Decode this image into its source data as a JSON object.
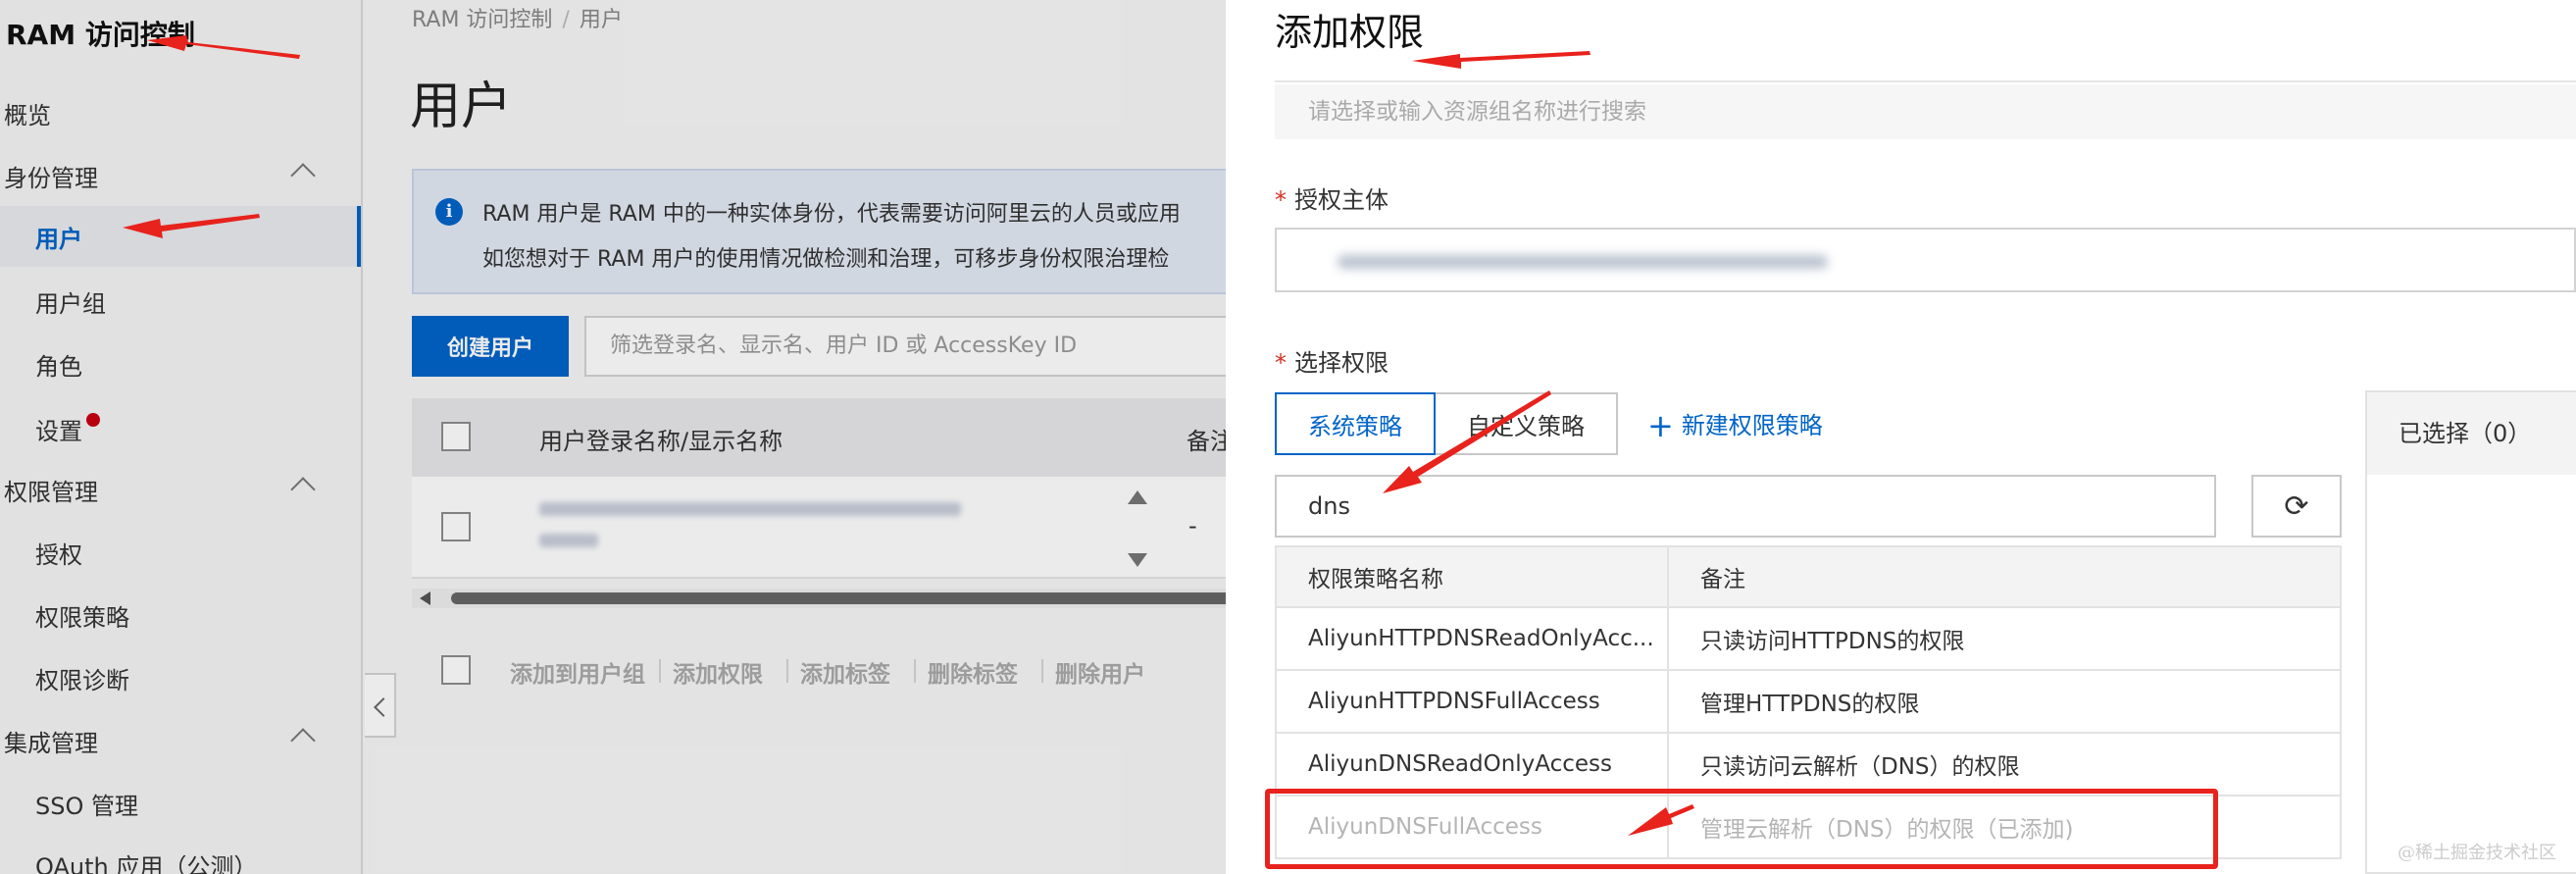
{
  "sidebar": {
    "title": "RAM 访问控制",
    "items": [
      {
        "label": "概览"
      },
      {
        "label": "身份管理"
      },
      {
        "label": "用户"
      },
      {
        "label": "用户组"
      },
      {
        "label": "角色"
      },
      {
        "label": "设置"
      },
      {
        "label": "权限管理"
      },
      {
        "label": "授权"
      },
      {
        "label": "权限策略"
      },
      {
        "label": "权限诊断"
      },
      {
        "label": "集成管理"
      },
      {
        "label": "SSO 管理"
      },
      {
        "label": "OAuth 应用（公测）"
      }
    ]
  },
  "main": {
    "breadcrumb": [
      "RAM 访问控制",
      "用户"
    ],
    "breadcrumb_sep": "/",
    "title": "用户",
    "info_line1": "RAM 用户是 RAM 中的一种实体身份，代表需要访问阿里云的人员或应用",
    "info_line2": "如您想对于 RAM 用户的使用情况做检测和治理，可移步身份权限治理检",
    "create_button": "创建用户",
    "filter_placeholder": "筛选登录名、显示名、用户 ID 或 AccessKey ID",
    "columns": [
      "用户登录名称/显示名称",
      "备注"
    ],
    "row_note": "-",
    "bulk_actions": [
      "添加到用户组",
      "添加权限",
      "添加标签",
      "删除标签",
      "删除用户"
    ]
  },
  "drawer": {
    "title": "添加权限",
    "resource_group_placeholder": "请选择或输入资源组名称进行搜索",
    "principal_label": "授权主体",
    "select_label": "选择权限",
    "required_mark": "*",
    "tabs": [
      "系统策略",
      "自定义策略"
    ],
    "new_policy": "新建权限策略",
    "new_policy_plus": "+",
    "search_value": "dns",
    "refresh_glyph": "⟳",
    "table_headers": [
      "权限策略名称",
      "备注"
    ],
    "rows": [
      {
        "name": "AliyunHTTPDNSReadOnlyAcc...",
        "note": "只读访问HTTPDNS的权限"
      },
      {
        "name": "AliyunHTTPDNSFullAccess",
        "note": "管理HTTPDNS的权限"
      },
      {
        "name": "AliyunDNSReadOnlyAccess",
        "note": "只读访问云解析（DNS）的权限"
      },
      {
        "name": "AliyunDNSFullAccess",
        "note": "管理云解析（DNS）的权限（已添加)"
      }
    ],
    "selected_label": "已选择（0）"
  },
  "watermark": "@稀土掘金技术社区",
  "colors": {
    "primary": "#0064c8",
    "annotation_red": "#e8221c",
    "required_red": "#d93026",
    "badge_red": "#c80010"
  }
}
